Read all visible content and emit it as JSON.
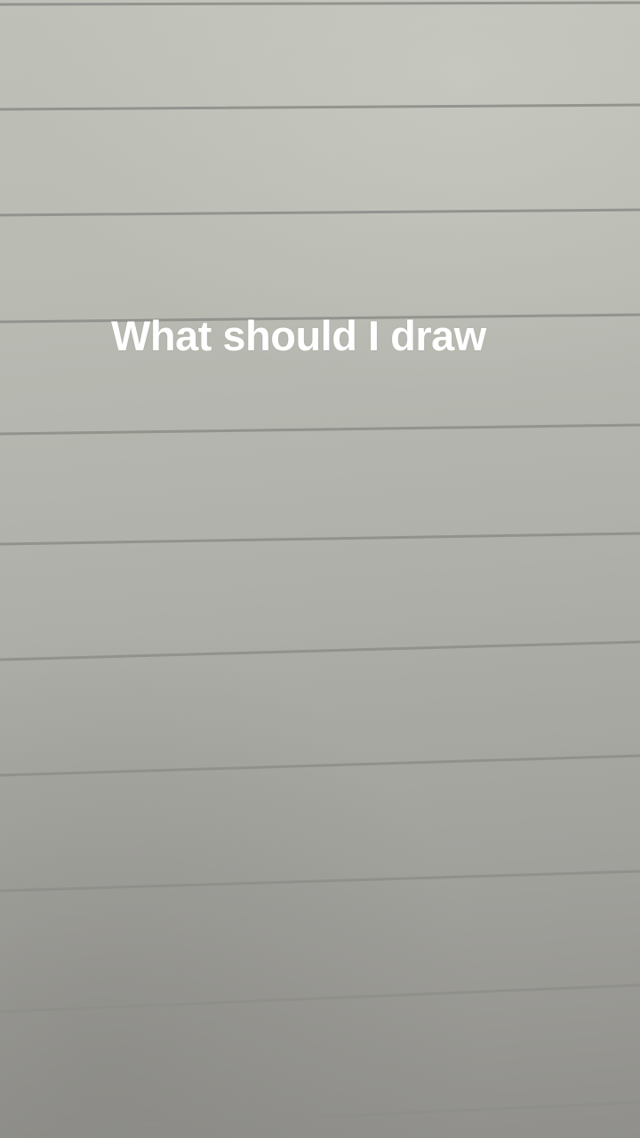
{
  "caption": {
    "text": "What should I draw"
  },
  "background": {
    "subject": "ruled-notebook-paper",
    "line_color": "#8e8f8a",
    "paper_color": "#b4b5ae"
  }
}
